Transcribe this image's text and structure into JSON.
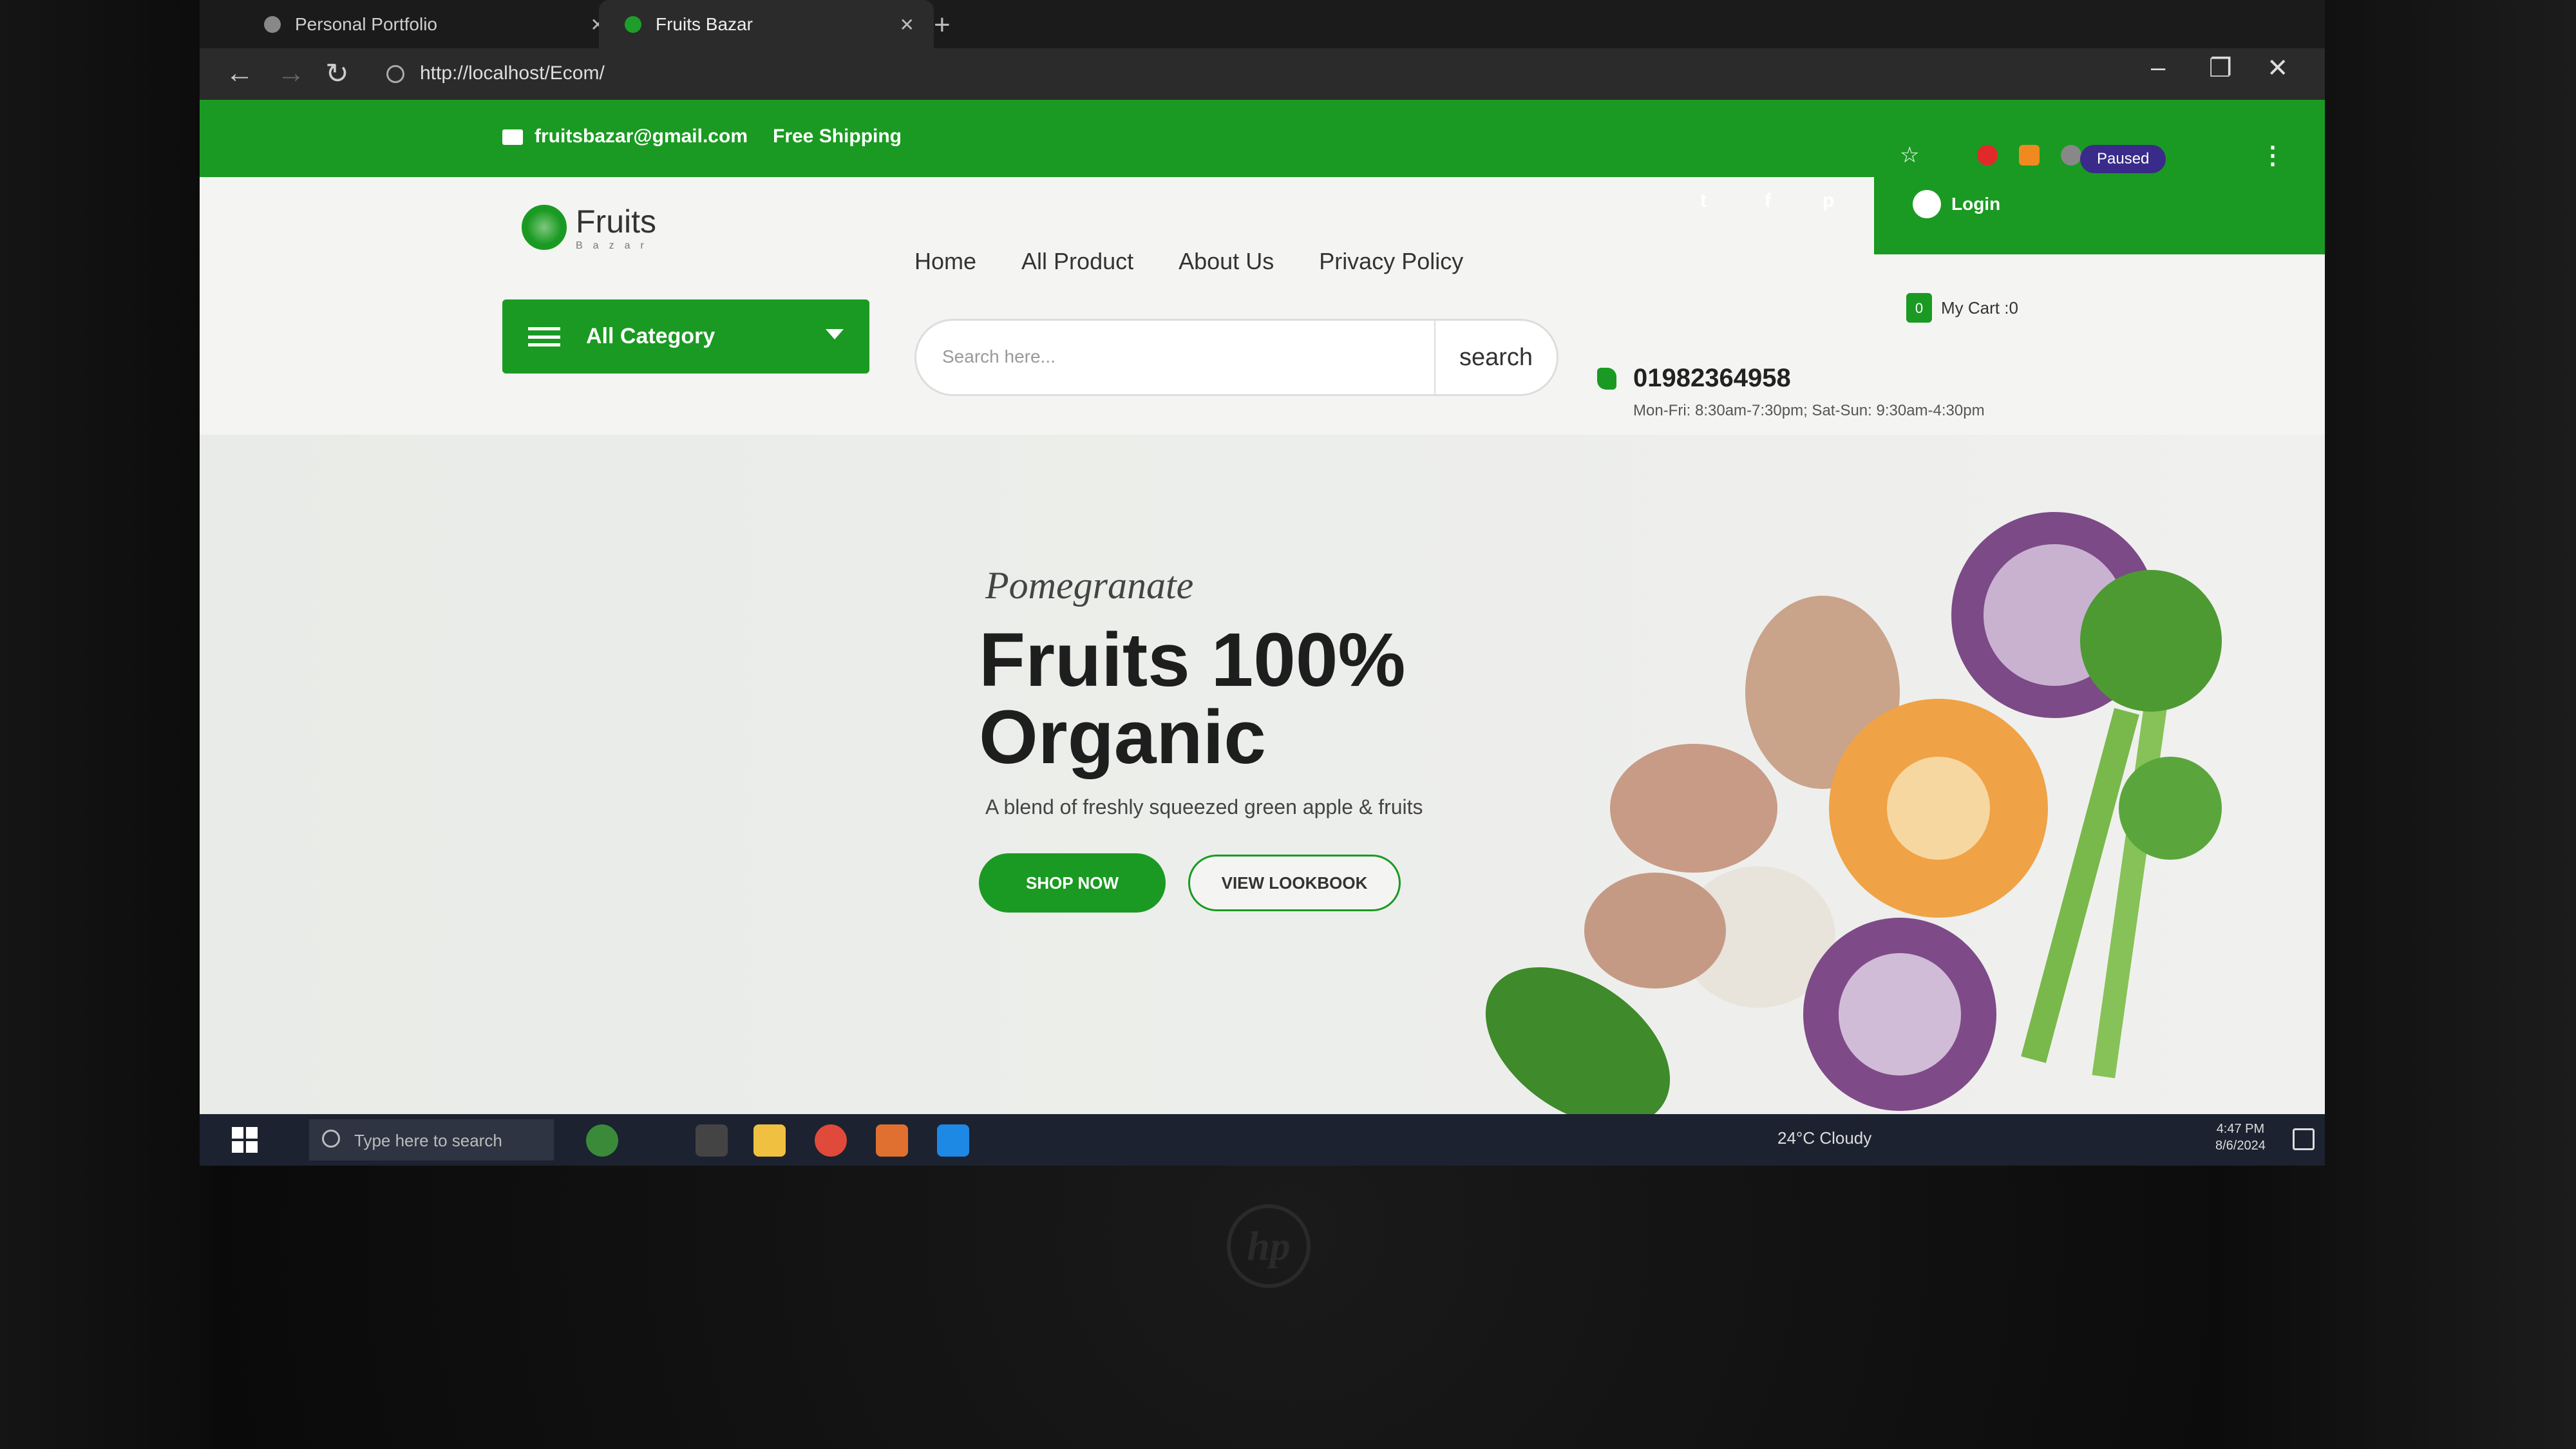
{
  "browser": {
    "tabs": [
      {
        "label": "Personal Portfolio"
      },
      {
        "label": "Fruits Bazar"
      }
    ],
    "new_tab": "+",
    "url": "http://localhost/Ecom/",
    "profile_status": "Paused"
  },
  "topbar": {
    "email": "fruitsbazar@gmail.com",
    "shipping": "Free Shipping",
    "login": "Login"
  },
  "header": {
    "brand": "Fruits",
    "brand_sub": "Bazar",
    "category_button": "All Category",
    "nav": [
      "Home",
      "All Product",
      "About Us",
      "Privacy Policy"
    ],
    "search_placeholder": "Search here...",
    "search_button": "search",
    "phone": "01982364958",
    "hours": "Mon-Fri: 8:30am-7:30pm; Sat-Sun: 9:30am-4:30pm",
    "cart_count": "0",
    "cart_label": "My Cart :0"
  },
  "hero": {
    "kicker": "Pomegranate",
    "headline_line1": "Fruits 100%",
    "headline_line2": "Organic",
    "blurb": "A blend of freshly squeezed green apple & fruits",
    "shop_button": "SHOP NOW",
    "lookbook_button": "VIEW LOOKBOOK"
  },
  "taskbar": {
    "search_placeholder": "Type here to search",
    "weather": "24°C  Cloudy",
    "time": "4:47 PM",
    "date": "8/6/2024"
  },
  "colors": {
    "brand_green": "#1a9a22",
    "page_bg": "#f4f5f2"
  },
  "icons": [
    "mail-icon",
    "twitter-icon",
    "facebook-icon",
    "pinterest-icon",
    "user-icon",
    "menu-icon",
    "phone-icon",
    "bag-icon",
    "windows-icon",
    "search-icon"
  ]
}
